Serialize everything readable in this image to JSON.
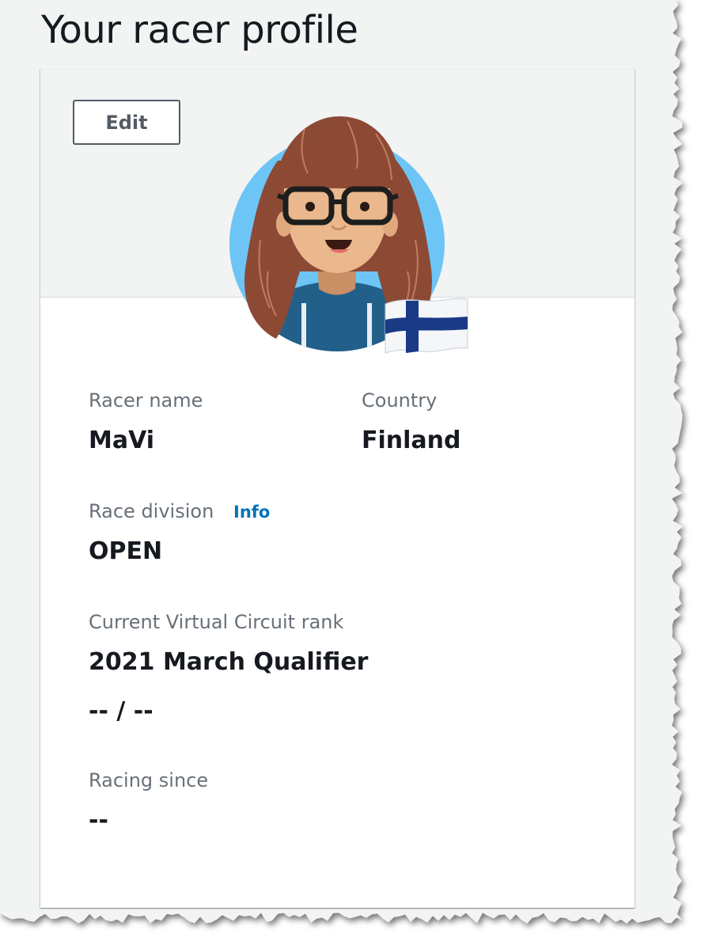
{
  "page": {
    "title": "Your racer profile"
  },
  "profile_card": {
    "edit_label": "Edit",
    "avatar_icon": "racer-avatar-icon",
    "flag_icon": "finland-flag-icon",
    "fields": {
      "racer_name": {
        "label": "Racer name",
        "value": "MaVi"
      },
      "country": {
        "label": "Country",
        "value": "Finland"
      },
      "race_division": {
        "label": "Race division",
        "info_label": "Info",
        "value": "OPEN"
      },
      "circuit_rank": {
        "label": "Current Virtual Circuit rank",
        "event": "2021 March Qualifier",
        "rank": "-- / --"
      },
      "racing_since": {
        "label": "Racing since",
        "value": "--"
      }
    }
  },
  "colors": {
    "title": "#16191f",
    "label": "#687078",
    "value": "#16191f",
    "link": "#0073bb",
    "header_bg": "#f2f3f3",
    "avatar_bg": "#6cc5f5",
    "hair": "#8c4a35",
    "shirt": "#236089",
    "flag_blue": "#1a3a86"
  }
}
